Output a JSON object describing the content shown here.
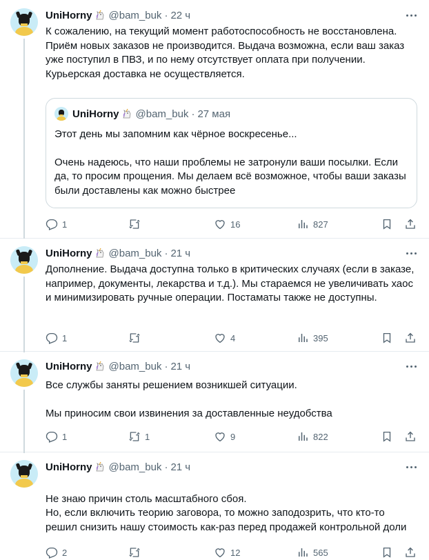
{
  "colors": {
    "text": "#0f1419",
    "secondary": "#536471",
    "border": "#cfd9de",
    "avatar_bg": "#c9ecf7"
  },
  "tweets": [
    {
      "name": "UniHorny",
      "handle": "@bam_buk",
      "time": "22 ч",
      "text": [
        "К сожалению, на текущий момент работоспособность не восстановлена. Приём новых заказов не производится. Выдача возможна, если ваш заказ уже поступил в ПВЗ, и по нему отсутствует оплата при получении. Курьерская доставка не осуществляется."
      ],
      "quote": {
        "name": "UniHorny",
        "handle": "@bam_buk",
        "time": "27 мая",
        "text": [
          "Этот день мы запомним как чёрное воскресенье...",
          "Очень надеюсь, что наши проблемы не затронули ваши посылки. Если да, то просим прощения. Мы делаем всё возможное, чтобы ваши заказы были доставлены как можно быстрее"
        ]
      },
      "replies": "1",
      "retweets": "",
      "likes": "16",
      "views": "827"
    },
    {
      "name": "UniHorny",
      "handle": "@bam_buk",
      "time": "21 ч",
      "text": [
        "Дополнение. Выдача доступна только в критических случаях (если в заказе, например, документы, лекарства и т.д.). Мы стараемся не увеличивать хаос и минимизировать ручные операции. Постаматы также не доступны."
      ],
      "replies": "1",
      "retweets": "",
      "likes": "4",
      "views": "395"
    },
    {
      "name": "UniHorny",
      "handle": "@bam_buk",
      "time": "21 ч",
      "text": [
        "Все службы заняты решением возникшей ситуации.",
        "Мы приносим свои извинения за доставленные неудобства"
      ],
      "replies": "1",
      "retweets": "1",
      "likes": "9",
      "views": "822"
    },
    {
      "name": "UniHorny",
      "handle": "@bam_buk",
      "time": "21 ч",
      "text": [
        "Не знаю причин столь масштабного сбоя.\nНо, если включить теорию заговора, то можно заподозрить, что кто-то решил снизить нашу стоимость как-раз перед продажей контрольной доли"
      ],
      "replies": "2",
      "retweets": "",
      "likes": "12",
      "views": "565"
    }
  ]
}
